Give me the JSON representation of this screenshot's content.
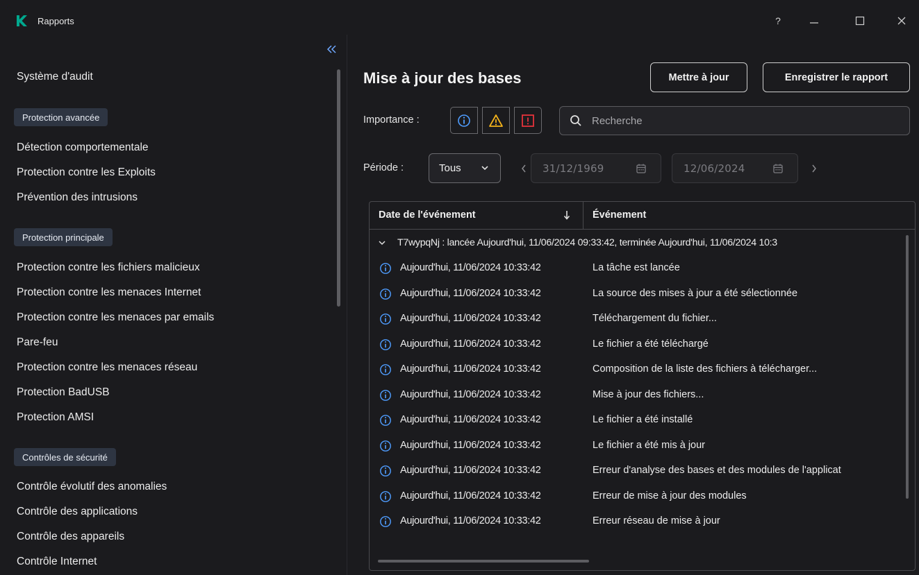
{
  "window": {
    "title": "Rapports",
    "help": "?",
    "minimize": "—",
    "maximize": "☐",
    "close": "✕"
  },
  "sidebar": {
    "collapse": "<<",
    "items": [
      {
        "type": "item",
        "label": "Système d'audit"
      },
      {
        "type": "group",
        "label": "Protection avancée"
      },
      {
        "type": "item",
        "label": "Détection comportementale"
      },
      {
        "type": "item",
        "label": "Protection contre les Exploits"
      },
      {
        "type": "item",
        "label": "Prévention des intrusions"
      },
      {
        "type": "group",
        "label": "Protection principale"
      },
      {
        "type": "item",
        "label": "Protection contre les fichiers malicieux"
      },
      {
        "type": "item",
        "label": "Protection contre les menaces Internet"
      },
      {
        "type": "item",
        "label": "Protection contre les menaces par emails"
      },
      {
        "type": "item",
        "label": "Pare-feu"
      },
      {
        "type": "item",
        "label": "Protection contre les menaces réseau"
      },
      {
        "type": "item",
        "label": "Protection BadUSB"
      },
      {
        "type": "item",
        "label": "Protection AMSI"
      },
      {
        "type": "group",
        "label": "Contrôles de sécurité"
      },
      {
        "type": "item",
        "label": "Contrôle évolutif des anomalies"
      },
      {
        "type": "item",
        "label": "Contrôle des applications"
      },
      {
        "type": "item",
        "label": "Contrôle des appareils"
      },
      {
        "type": "item",
        "label": "Contrôle Internet"
      }
    ]
  },
  "main": {
    "title": "Mise à jour des bases",
    "update_button": "Mettre à jour",
    "save_report_button": "Enregistrer le rapport",
    "importance_label": "Importance :",
    "search_placeholder": "Recherche",
    "period_label": "Période :",
    "period_value": "Tous",
    "date_from": "31/12/1969",
    "date_to": "12/06/2024"
  },
  "table": {
    "columns": [
      "Date de l'événement",
      "Événement"
    ],
    "group_text": "T7wypqNj : lancée Aujourd'hui, 11/06/2024 09:33:42, terminée Aujourd'hui, 11/06/2024 10:3",
    "rows": [
      {
        "date": "Aujourd'hui, 11/06/2024 10:33:42",
        "event": "La tâche est lancée"
      },
      {
        "date": "Aujourd'hui, 11/06/2024 10:33:42",
        "event": "La source des mises à jour a été sélectionnée"
      },
      {
        "date": "Aujourd'hui, 11/06/2024 10:33:42",
        "event": "Téléchargement du fichier..."
      },
      {
        "date": "Aujourd'hui, 11/06/2024 10:33:42",
        "event": "Le fichier a été téléchargé"
      },
      {
        "date": "Aujourd'hui, 11/06/2024 10:33:42",
        "event": "Composition de la liste des fichiers à télécharger..."
      },
      {
        "date": "Aujourd'hui, 11/06/2024 10:33:42",
        "event": "Mise à jour des fichiers..."
      },
      {
        "date": "Aujourd'hui, 11/06/2024 10:33:42",
        "event": "Le fichier a été installé"
      },
      {
        "date": "Aujourd'hui, 11/06/2024 10:33:42",
        "event": "Le fichier a été mis à jour"
      },
      {
        "date": "Aujourd'hui, 11/06/2024 10:33:42",
        "event": "Erreur d'analyse des bases et des modules de l'applicat"
      },
      {
        "date": "Aujourd'hui, 11/06/2024 10:33:42",
        "event": "Erreur de mise à jour des modules"
      },
      {
        "date": "Aujourd'hui, 11/06/2024 10:33:42",
        "event": "Erreur réseau de mise à jour"
      }
    ]
  },
  "colors": {
    "background": "#1b1b1e",
    "accent_blue": "#6fa8ff",
    "info_blue": "#4f9dff",
    "warning_yellow": "#f2b21b",
    "critical_red": "#e5333b",
    "brand_green": "#00a88e",
    "group_chip": "#2e3542"
  }
}
